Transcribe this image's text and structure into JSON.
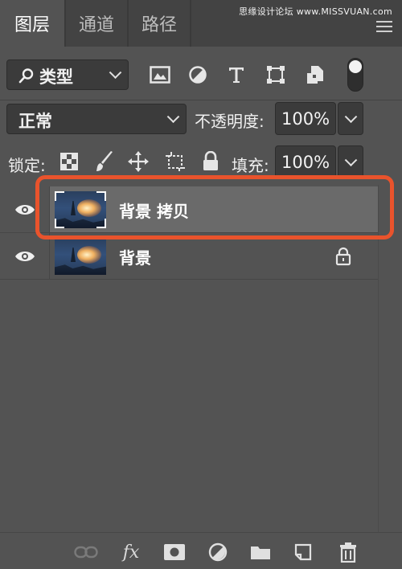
{
  "tabs": [
    {
      "label": "图层",
      "active": true
    },
    {
      "label": "通道",
      "active": false
    },
    {
      "label": "路径",
      "active": false
    }
  ],
  "watermark": "思缘设计论坛 www.MISSVUAN.com",
  "filter": {
    "kind_label": "类型",
    "icons": [
      "image-filter-icon",
      "adjustment-filter-icon",
      "type-filter-icon",
      "shape-filter-icon",
      "smart-object-filter-icon"
    ]
  },
  "blend": {
    "mode": "正常",
    "opacity_label": "不透明度:",
    "opacity_value": "100%"
  },
  "lock": {
    "label": "锁定:",
    "icons": [
      "lock-transparent-pixels-icon",
      "lock-image-pixels-icon",
      "lock-position-icon",
      "lock-artboard-icon",
      "lock-all-icon"
    ],
    "fill_label": "填充:",
    "fill_value": "100%"
  },
  "layers": [
    {
      "name": "背景 拷贝",
      "visible": true,
      "selected": true,
      "locked": false
    },
    {
      "name": "背景",
      "visible": true,
      "selected": false,
      "locked": true
    }
  ],
  "bottom_icons": [
    "link-layers-icon",
    "fx-icon",
    "add-mask-icon",
    "new-adjustment-icon",
    "new-group-icon",
    "new-layer-icon",
    "delete-layer-icon"
  ],
  "fx_label": "fx",
  "colors": {
    "panel_bg": "#535353",
    "selected_row": "#6a6a6a",
    "highlight": "#e9532c"
  }
}
